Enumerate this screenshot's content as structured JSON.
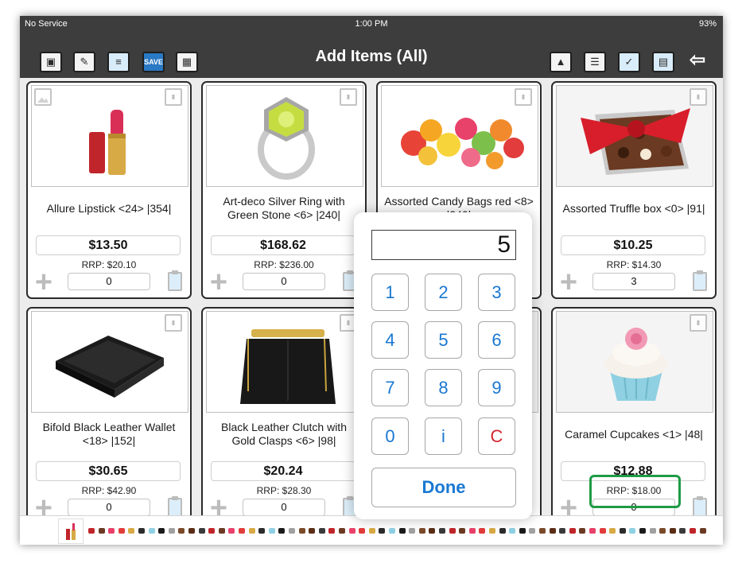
{
  "status_bar": {
    "carrier": "No Service",
    "time": "1:00 PM",
    "battery": "93%"
  },
  "toolbar": {
    "title": "Add Items (All)",
    "save_badge": "SAVE"
  },
  "products": [
    {
      "name": "Allure Lipstick <24> |354|",
      "price": "$13.50",
      "rrp": "RRP: $20.10",
      "qty": "0"
    },
    {
      "name": "Art-deco Silver Ring with Green Stone <6> |240|",
      "price": "$168.62",
      "rrp": "RRP: $236.00",
      "qty": "0"
    },
    {
      "name": "Assorted Candy Bags red <8> |240|",
      "price": "",
      "rrp": "",
      "qty": ""
    },
    {
      "name": "Assorted Truffle box <0> |91|",
      "price": "$10.25",
      "rrp": "RRP: $14.30",
      "qty": "3"
    },
    {
      "name": "Bifold Black Leather Wallet <18> |152|",
      "price": "$30.65",
      "rrp": "RRP: $42.90",
      "qty": "0"
    },
    {
      "name": "Black Leather Clutch with Gold Clasps <6> |98|",
      "price": "$20.24",
      "rrp": "RRP: $28.30",
      "qty": "0"
    },
    {
      "name": "Caramel Cupcakes <1> |48|",
      "price": "$12.88",
      "rrp": "RRP: $18.00",
      "qty": "0"
    }
  ],
  "keypad": {
    "display": "5",
    "keys": [
      "1",
      "2",
      "3",
      "4",
      "5",
      "6",
      "7",
      "8",
      "9",
      "0",
      "i",
      "C"
    ],
    "done": "Done"
  },
  "colors": {
    "toolbar_bg": "#3d3d3d",
    "key_text": "#1a78d2",
    "clear_key": "#d2272f",
    "highlight": "#1f9b46"
  },
  "icons": {
    "toolbar_left": [
      "inventory-box-icon",
      "notes-icon",
      "receipt-icon",
      "save-document-icon",
      "calculator-icon"
    ],
    "toolbar_right": [
      "image-view-icon",
      "list-view-icon",
      "document-check-icon",
      "clipboard-icon",
      "back-arrow-icon"
    ]
  }
}
